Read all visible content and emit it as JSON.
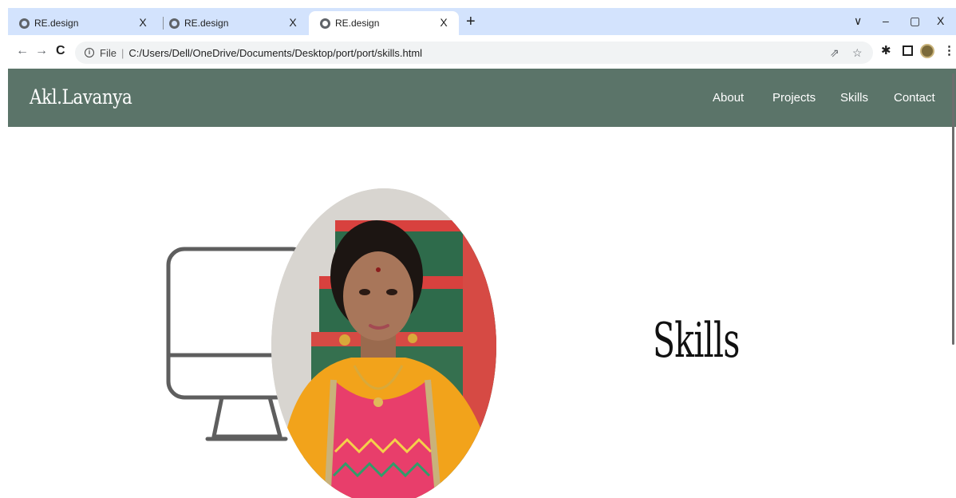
{
  "browser": {
    "tabs": [
      {
        "title": "RE.design",
        "close": "X",
        "active": false
      },
      {
        "title": "RE.design",
        "close": "X",
        "active": false
      },
      {
        "title": "RE.design",
        "close": "X",
        "active": true
      }
    ],
    "new_tab": "+",
    "window_controls": {
      "dropdown": "∨",
      "minimize": "–",
      "restore": "▢",
      "close": "X"
    },
    "scheme": "File",
    "url": "C:/Users/Dell/OneDrive/Documents/Desktop/port/port/skills.html",
    "icons": [
      "back-icon",
      "forward-icon",
      "reload-icon",
      "share-icon",
      "star-icon",
      "extensions-icon",
      "sidepanel-icon",
      "profile-icon",
      "menu-icon"
    ]
  },
  "site": {
    "logo": "Akl.Lavanya",
    "nav": [
      "About",
      "Projects",
      "Skills",
      "Contact"
    ],
    "section_title": "Skills"
  },
  "colors": {
    "header_bg": "#5b7469",
    "tabbar_bg": "#d3e3fd",
    "page_bg": "#ffffff",
    "title_color": "#111111"
  }
}
